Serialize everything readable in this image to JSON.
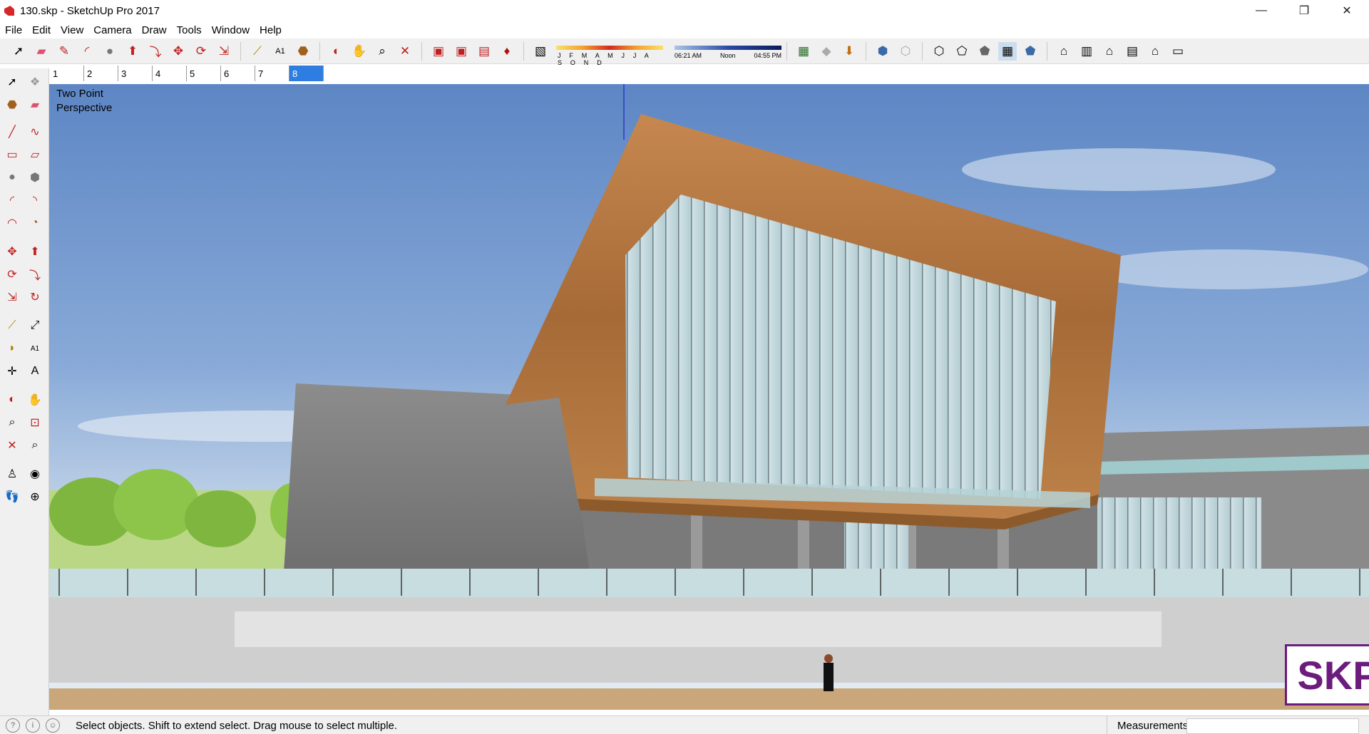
{
  "window": {
    "title": "130.skp - SketchUp Pro 2017",
    "minimize": "—",
    "restore": "❐",
    "close": "✕"
  },
  "menu": [
    "File",
    "Edit",
    "View",
    "Camera",
    "Draw",
    "Tools",
    "Window",
    "Help"
  ],
  "toolbar": {
    "icons": [
      "select-icon",
      "eraser-icon",
      "pencil-icon",
      "circle-arc-icon",
      "circle-icon",
      "push-pull-icon",
      "follow-me-icon",
      "move-icon",
      "rotate-icon",
      "scale-icon",
      "tape-measure-icon",
      "text-icon",
      "paint-bucket-icon",
      "orbit-icon",
      "pan-icon",
      "zoom-icon",
      "zoom-extents-icon",
      "3d-warehouse-icon",
      "extension-warehouse-icon",
      "layout-icon",
      "ruby-icon",
      "shadow-toggle-icon"
    ],
    "months": "J F M A M J J A S O N D",
    "time_start": "06:21 AM",
    "time_noon": "Noon",
    "time_end": "04:55 PM",
    "right_icons": [
      "geo-location-icon",
      "add-photo-icon",
      "import-icon",
      "xray-icon",
      "back-edges-icon",
      "wireframe-icon",
      "hidden-line-icon",
      "shaded-icon",
      "shaded-textures-icon",
      "monochrome-icon",
      "iso-view-icon",
      "top-view-icon",
      "front-view-icon",
      "right-view-icon",
      "back-view-icon",
      "left-view-icon"
    ]
  },
  "scene_tabs": [
    "1",
    "2",
    "3",
    "4",
    "5",
    "6",
    "7",
    "8"
  ],
  "active_scene": "8",
  "viewport": {
    "camera_label_line1": "Two Point",
    "camera_label_line2": "Perspective",
    "logo_text": "SKP"
  },
  "statusbar": {
    "text": "Select objects. Shift to extend select. Drag mouse to select multiple.",
    "measurements_label": "Measurements",
    "measurements_value": ""
  },
  "colors": {
    "accent": "#2e7de0",
    "wood": "#b77a43",
    "logo": "#6c1c7d"
  }
}
